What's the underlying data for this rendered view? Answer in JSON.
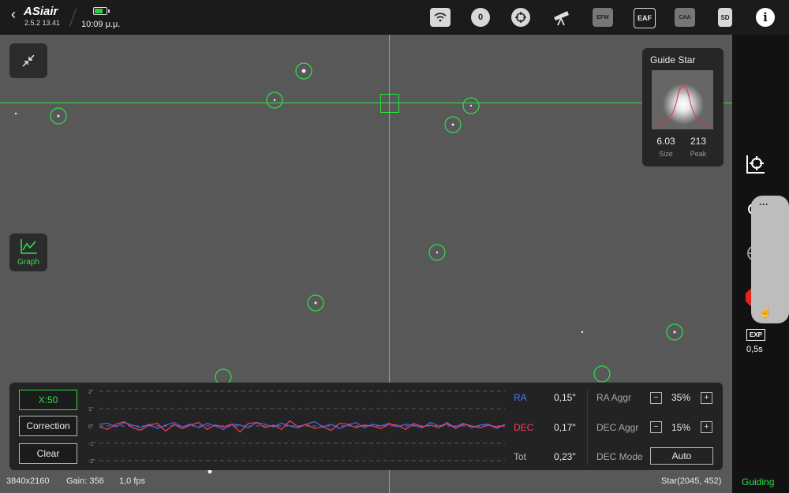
{
  "app": {
    "logo": "ASiair",
    "version": "2.5.2 13.41",
    "time": "10:09 μ.μ.",
    "battery_level": 0.7
  },
  "top_icons": [
    {
      "name": "wifi-icon",
      "label": ""
    },
    {
      "name": "camera-icon",
      "label": "0"
    },
    {
      "name": "guide-scope-icon",
      "label": ""
    },
    {
      "name": "telescope-icon",
      "label": ""
    },
    {
      "name": "efw-icon",
      "label": "EFW"
    },
    {
      "name": "eaf-icon",
      "label": "EAF"
    },
    {
      "name": "caa-icon",
      "label": "CAA"
    },
    {
      "name": "sd-card-icon",
      "label": "SD"
    }
  ],
  "guide_star": {
    "title": "Guide Star",
    "size_value": "6.03",
    "size_label": "Size",
    "peak_value": "213",
    "peak_label": "Peak"
  },
  "graph_button": {
    "label": "Graph"
  },
  "guide_panel": {
    "x_scale": "X:50",
    "correction": "Correction",
    "clear": "Clear",
    "y_ticks": [
      "2\"",
      "1\"",
      "0\"",
      "-1\"",
      "-2\""
    ],
    "ra_label": "RA",
    "ra_value": "0,15\"",
    "dec_label": "DEC",
    "dec_value": "0,17\"",
    "tot_label": "Tot",
    "tot_value": "0,23\"",
    "ra_aggr_label": "RA Aggr",
    "ra_aggr_value": "35%",
    "dec_aggr_label": "DEC Aggr",
    "dec_aggr_value": "15%",
    "dec_mode_label": "DEC Mode",
    "dec_mode_value": "Auto",
    "minus": "−",
    "plus": "+"
  },
  "status": {
    "resolution": "3840x2160",
    "gain": "Gain: 356",
    "fps": "1,0 fps",
    "star": "Star(2045, 452)",
    "state": "Guiding"
  },
  "exposure": {
    "badge": "EXP",
    "value": "0,5s"
  },
  "chart_data": {
    "type": "line",
    "ylim": [
      -2,
      2
    ],
    "y_ticks": [
      "2\"",
      "1\"",
      "0\"",
      "-1\"",
      "-2\""
    ],
    "series": [
      {
        "name": "RA",
        "color": "#3f6fff",
        "values": [
          0.1,
          0.15,
          -0.05,
          0.2,
          0.05,
          -0.1,
          0.1,
          -0.15,
          0.05,
          0.2,
          -0.05,
          0.1,
          -0.1,
          0.15,
          0.0,
          -0.2,
          0.1,
          0.05,
          -0.1,
          0.2,
          0.1,
          -0.05,
          0.15,
          0.0,
          -0.1,
          0.1,
          0.25,
          -0.05,
          0.1,
          -0.15,
          0.05,
          0.2,
          -0.1,
          0.1,
          0.0,
          0.15,
          -0.05,
          0.1,
          0.05,
          -0.1,
          0.2,
          0.0,
          0.1,
          -0.05,
          0.15,
          -0.1,
          0.05,
          0.1,
          -0.15,
          0.1
        ]
      },
      {
        "name": "DEC",
        "color": "#ff3b5c",
        "values": [
          -0.05,
          -0.2,
          0.1,
          0.25,
          -0.1,
          -0.25,
          0.05,
          0.15,
          -0.3,
          0.1,
          -0.15,
          0.05,
          0.2,
          -0.2,
          0.05,
          -0.05,
          0.1,
          -0.35,
          0.15,
          0.2,
          -0.1,
          0.05,
          -0.2,
          0.3,
          -0.05,
          0.1,
          -0.15,
          -0.05,
          -0.25,
          0.15,
          0.1,
          -0.1,
          0.05,
          0.0,
          -0.15,
          0.1,
          0.05,
          -0.2,
          0.15,
          -0.05,
          0.05,
          -0.1,
          0.2,
          -0.15,
          0.1,
          0.0,
          -0.1,
          0.05,
          -0.05,
          0.0
        ]
      }
    ]
  }
}
